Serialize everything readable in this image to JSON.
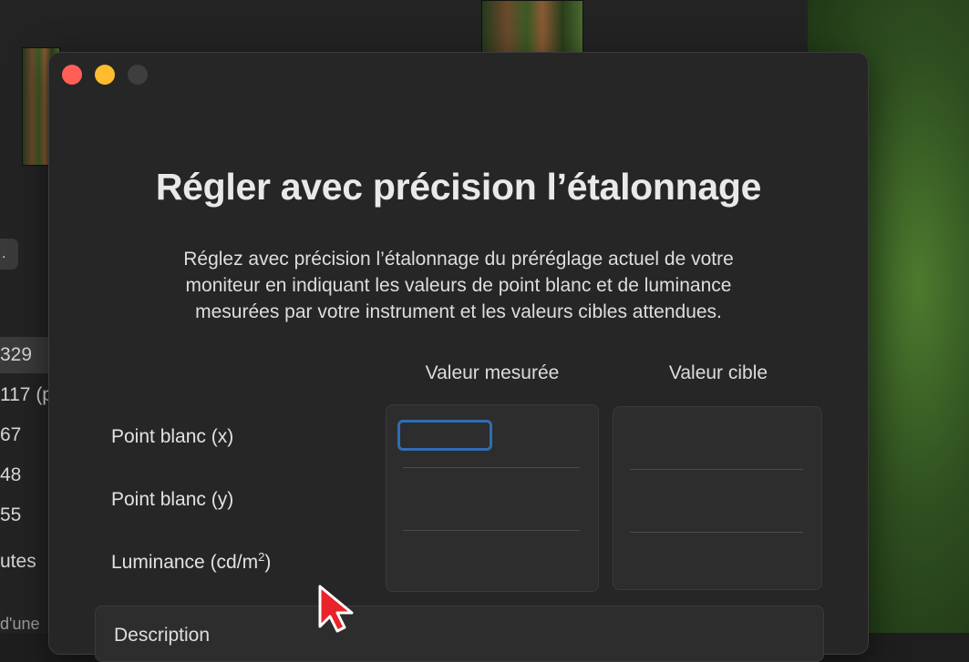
{
  "background_app": {
    "pill_label": ".",
    "rows": [
      {
        "text": "329",
        "selected": true
      },
      {
        "text": "117 (p",
        "selected": false
      },
      {
        "text": "67",
        "selected": false
      },
      {
        "text": "48",
        "selected": false
      },
      {
        "text": "55",
        "selected": false
      },
      {
        "text": "utes",
        "selected": false
      },
      {
        "text": "d'une",
        "selected": false
      }
    ]
  },
  "dialog": {
    "title": "Régler avec précision l’étalonnage",
    "description_lines": [
      "Réglez avec précision l’étalonnage du préréglage actuel de votre",
      "moniteur en indiquant les valeurs de point blanc et de luminance",
      "mesurées par votre instrument et les valeurs cibles attendues."
    ],
    "columns": {
      "measured": "Valeur mesurée",
      "target": "Valeur cible"
    },
    "rows": {
      "white_x": "Point blanc (x)",
      "white_y": "Point blanc (y)",
      "luminance": "Luminance (cd/m",
      "luminance_sup": "2",
      "luminance_end": ")"
    },
    "measured_values": {
      "white_x": "",
      "white_y": "",
      "luminance": ""
    },
    "target_values": {
      "white_x": "",
      "white_y": "",
      "luminance": ""
    },
    "description_panel_label": "Description"
  },
  "colors": {
    "close": "#ff5f57",
    "minimize": "#febc2e",
    "focus_ring": "#2f6db4",
    "cursor": "#e8242a"
  }
}
